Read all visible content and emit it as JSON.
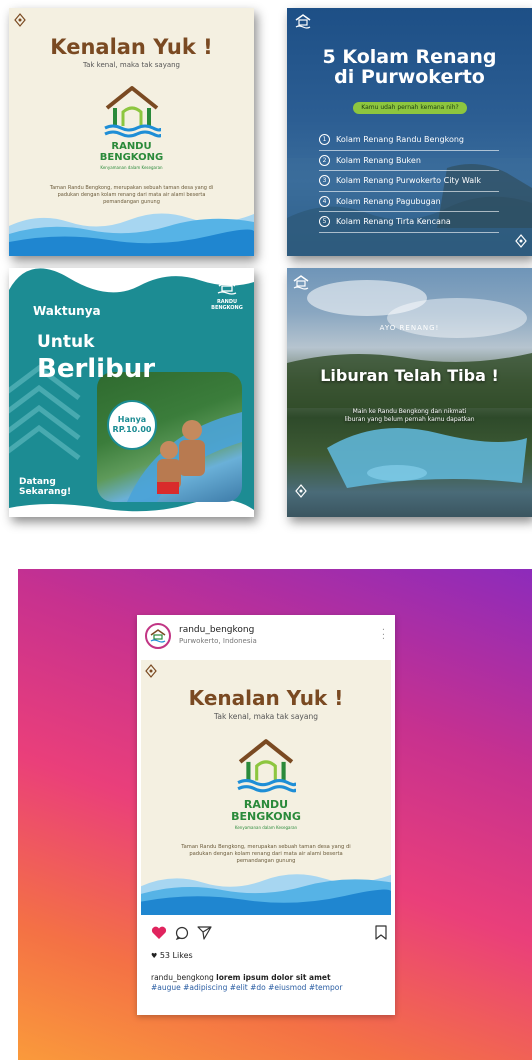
{
  "card1": {
    "title": "Kenalan Yuk !",
    "subtitle": "Tak kenal, maka tak sayang",
    "brand_line1": "RANDU",
    "brand_line2": "BENGKONG",
    "brand_tagline": "Kenyamanan dalam Kesegaran",
    "description": "Taman Randu Bengkong, merupakan sebuah taman desa yang di padukan dengan kolam renang dari mata air alami beserta pemandangan gunung"
  },
  "card2": {
    "title_line1": "5 Kolam Renang",
    "title_line2": "di Purwokerto",
    "pill": "Kamu udah pernah kemana nih?",
    "items": [
      {
        "num": "1",
        "label": "Kolam Renang Randu Bengkong"
      },
      {
        "num": "2",
        "label": "Kolam Renang Buken"
      },
      {
        "num": "3",
        "label": "Kolam Renang Purwokerto City Walk"
      },
      {
        "num": "4",
        "label": "Kolam Renang Pagubugan"
      },
      {
        "num": "5",
        "label": "Kolam Renang Tirta Kencana"
      }
    ]
  },
  "card3": {
    "waktunya": "Waktunya",
    "untuk": "Untuk",
    "berlibur": "Berlibur",
    "badge_line1": "Hanya",
    "badge_line2": "RP.10.00",
    "datang_line1": "Datang",
    "datang_line2": "Sekarang!",
    "logo_line1": "RANDU",
    "logo_line2": "BENGKONG"
  },
  "card4": {
    "ayo": "AYO RENANG!",
    "title": "Liburan Telah Tiba !",
    "desc_line1": "Main ke Randu Bengkong dan nikmati",
    "desc_line2": "liburan yang belum pernah kamu dapatkan"
  },
  "instagram": {
    "username": "randu_bengkong",
    "location": "Purwokerto, Indonesia",
    "likes": "53 Likes",
    "caption_user": "randu_bengkong",
    "caption_text": "lorem ipsum dolor sit amet",
    "caption_tags": "#augue #adipiscing #elit #do #eiusmod #tempor"
  },
  "colors": {
    "brown": "#7a4a22",
    "green": "#2a8a3a",
    "teal": "#1c8c93",
    "navy": "#1d4f86",
    "like_red": "#e0245e"
  },
  "icons": [
    "house-logo-icon",
    "diamond-logo-icon",
    "heart-icon",
    "comment-icon",
    "share-icon",
    "bookmark-icon"
  ]
}
